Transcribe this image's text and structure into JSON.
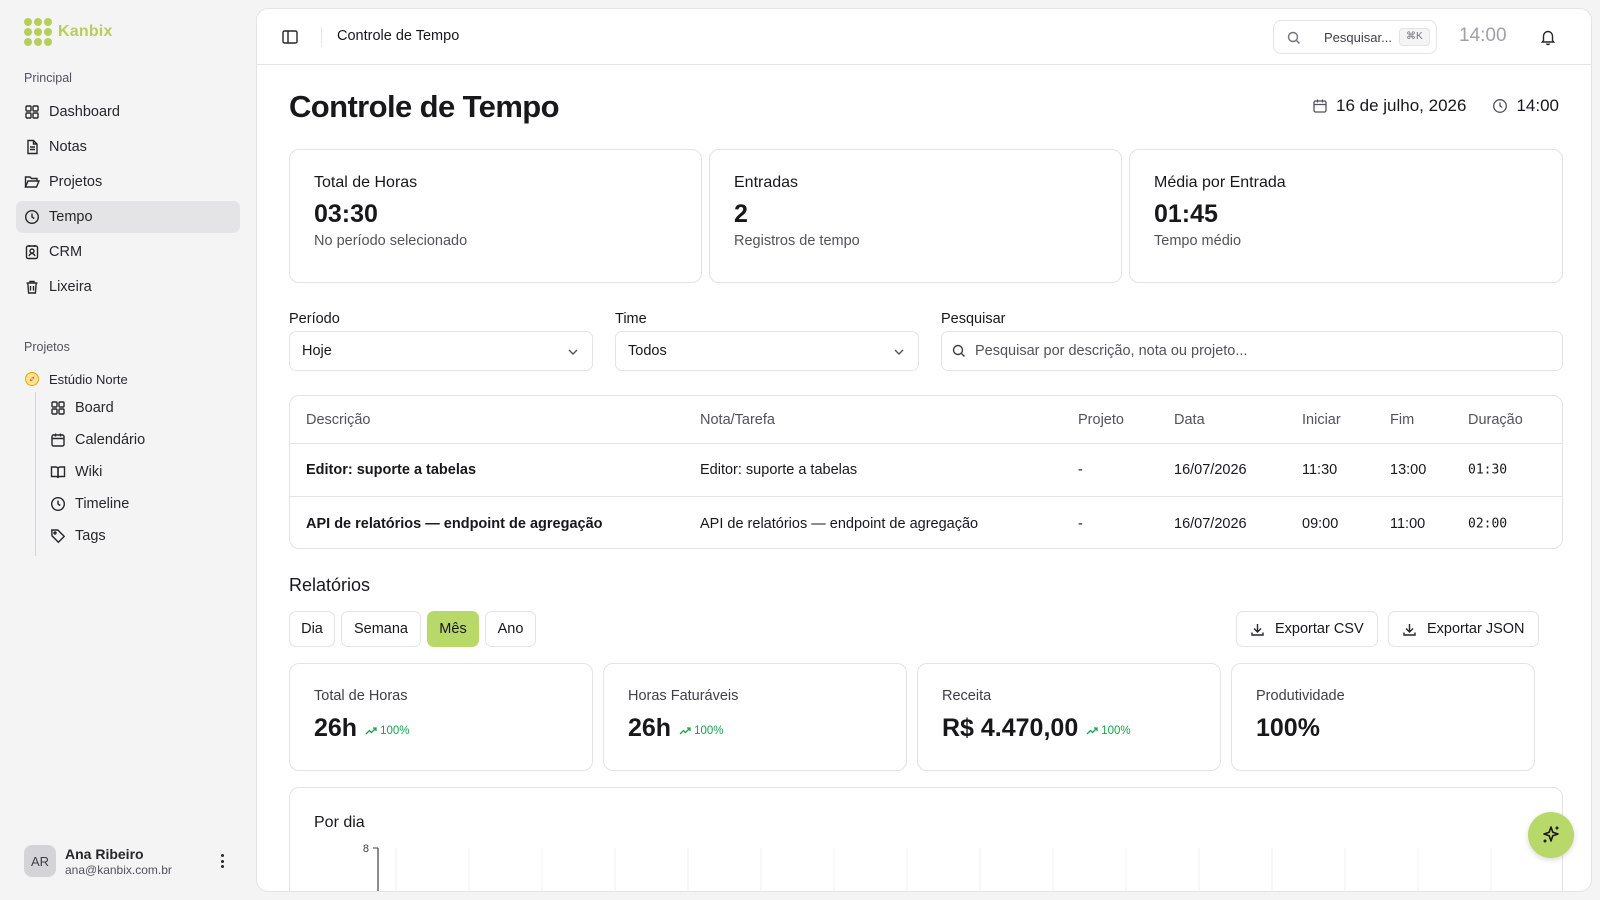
{
  "brand": {
    "name": "Kanbix",
    "color": "#b5cf5a"
  },
  "sidebar": {
    "principal_label": "Principal",
    "items": [
      {
        "label": "Dashboard",
        "icon": "dashboard-icon"
      },
      {
        "label": "Notas",
        "icon": "file-text-icon"
      },
      {
        "label": "Projetos",
        "icon": "folder-open-icon"
      },
      {
        "label": "Tempo",
        "icon": "clock-icon",
        "active": true
      },
      {
        "label": "CRM",
        "icon": "contact-icon"
      },
      {
        "label": "Lixeira",
        "icon": "trash-icon"
      }
    ],
    "projects_label": "Projetos",
    "project": {
      "name": "Estúdio Norte",
      "icon": "compass-icon"
    },
    "project_items": [
      {
        "label": "Board",
        "icon": "grid-icon"
      },
      {
        "label": "Calendário",
        "icon": "calendar-icon"
      },
      {
        "label": "Wiki",
        "icon": "book-icon"
      },
      {
        "label": "Timeline",
        "icon": "clock-icon"
      },
      {
        "label": "Tags",
        "icon": "tag-icon"
      }
    ],
    "user": {
      "initials": "AR",
      "name": "Ana Ribeiro",
      "email": "ana@kanbix.com.br"
    }
  },
  "topbar": {
    "title": "Controle de Tempo",
    "search_placeholder": "Pesquisar...",
    "search_shortcut": "⌘K",
    "time": "14:00"
  },
  "page": {
    "title": "Controle de Tempo",
    "date": "16 de julho, 2026",
    "time": "14:00"
  },
  "stats": [
    {
      "label": "Total de Horas",
      "value": "03:30",
      "sub": "No período selecionado"
    },
    {
      "label": "Entradas",
      "value": "2",
      "sub": "Registros de tempo"
    },
    {
      "label": "Média por Entrada",
      "value": "01:45",
      "sub": "Tempo médio"
    }
  ],
  "filters": {
    "period_label": "Período",
    "period_value": "Hoje",
    "team_label": "Time",
    "team_value": "Todos",
    "search_label": "Pesquisar",
    "search_placeholder": "Pesquisar por descrição, nota ou projeto..."
  },
  "table": {
    "headers": [
      "Descrição",
      "Nota/Tarefa",
      "Projeto",
      "Data",
      "Iniciar",
      "Fim",
      "Duração"
    ],
    "rows": [
      [
        "Editor: suporte a tabelas",
        "Editor: suporte a tabelas",
        "-",
        "16/07/2026",
        "11:30",
        "13:00",
        "01:30"
      ],
      [
        "API de relatórios — endpoint de agregação",
        "API de relatórios — endpoint de agregação",
        "-",
        "16/07/2026",
        "09:00",
        "11:00",
        "02:00"
      ]
    ]
  },
  "reports": {
    "title": "Relatórios",
    "tabs": [
      "Dia",
      "Semana",
      "Mês",
      "Ano"
    ],
    "active_tab": "Mês",
    "export_csv": "Exportar CSV",
    "export_json": "Exportar JSON",
    "cards": [
      {
        "label": "Total de Horas",
        "value": "26h",
        "trend": "100%"
      },
      {
        "label": "Horas Faturáveis",
        "value": "26h",
        "trend": "100%"
      },
      {
        "label": "Receita",
        "value": "R$ 4.470,00",
        "trend": "100%"
      },
      {
        "label": "Produtividade",
        "value": "100%",
        "trend": ""
      }
    ],
    "accent": "#b8d86a",
    "trend_color": "#16a34a"
  },
  "chart_data": {
    "type": "bar",
    "title": "Por dia",
    "y_ticks": [
      "8"
    ],
    "ylim": [
      0,
      8
    ],
    "grid": true,
    "categories": [],
    "values": []
  }
}
